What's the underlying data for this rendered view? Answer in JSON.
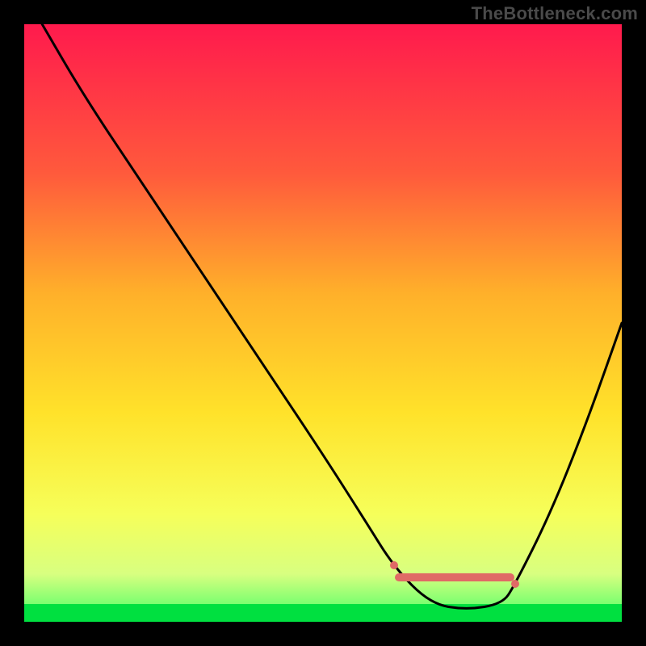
{
  "watermark": "TheBottleneck.com",
  "chart_data": {
    "type": "line",
    "title": "",
    "xlabel": "",
    "ylabel": "",
    "xlim": [
      0,
      100
    ],
    "ylim": [
      0,
      100
    ],
    "grid": false,
    "series": [
      {
        "name": "bottleneck-curve",
        "color": "#000000",
        "x": [
          3,
          10,
          20,
          30,
          40,
          50,
          57,
          62,
          68,
          74,
          80,
          82,
          88,
          94,
          100
        ],
        "values": [
          100,
          88,
          73,
          58,
          43,
          28,
          17,
          9,
          3,
          2,
          3,
          6,
          18,
          33,
          50
        ]
      }
    ],
    "valley_range_x": [
      62,
      82
    ],
    "background_gradient": {
      "stops": [
        {
          "pos": 0.0,
          "color": "#ff1a4d"
        },
        {
          "pos": 0.25,
          "color": "#ff5a3c"
        },
        {
          "pos": 0.45,
          "color": "#ffb02a"
        },
        {
          "pos": 0.65,
          "color": "#ffe22a"
        },
        {
          "pos": 0.82,
          "color": "#f6ff5a"
        },
        {
          "pos": 0.92,
          "color": "#d8ff80"
        },
        {
          "pos": 0.97,
          "color": "#7cff70"
        },
        {
          "pos": 1.0,
          "color": "#00e040"
        }
      ]
    }
  }
}
